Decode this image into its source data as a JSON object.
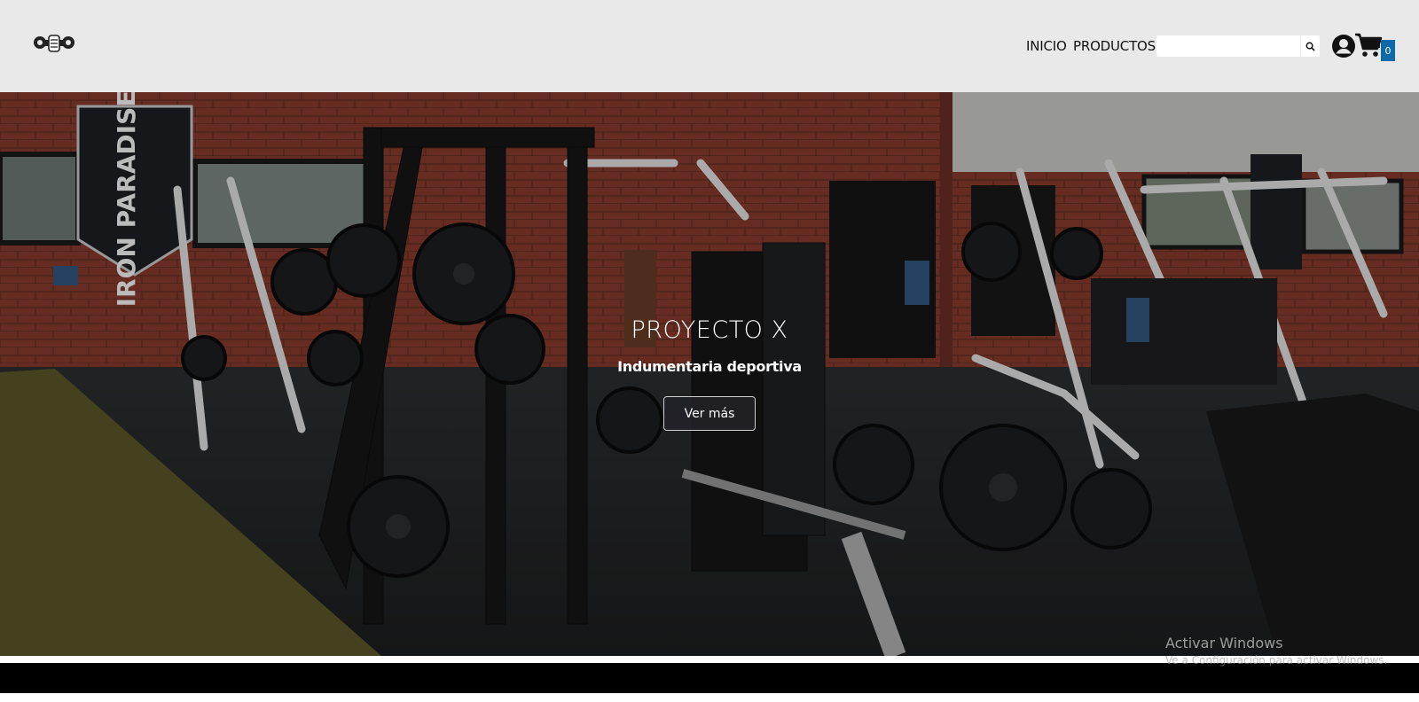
{
  "header": {
    "logo_icon": "gym-fist-logo-icon",
    "nav": [
      {
        "label": "INICIO"
      },
      {
        "label": "PRODUCTOS"
      }
    ],
    "search": {
      "placeholder": "",
      "value": "",
      "button_icon": "search-icon"
    },
    "user_icon": "user-circle-icon",
    "cart": {
      "icon": "cart-icon",
      "count": "0"
    }
  },
  "hero": {
    "title": "PROYECTO X",
    "subtitle": "Indumentaria deportiva",
    "button_label": "Ver más",
    "banner_text": "IRON PARADISE"
  },
  "os_watermark": {
    "title": "Activar Windows",
    "subtitle": "Ve a Configuración para activar Windows."
  },
  "colors": {
    "header_bg": "#e9e9e9",
    "cart_badge": "#0b6aa8",
    "footer": "#000000"
  }
}
